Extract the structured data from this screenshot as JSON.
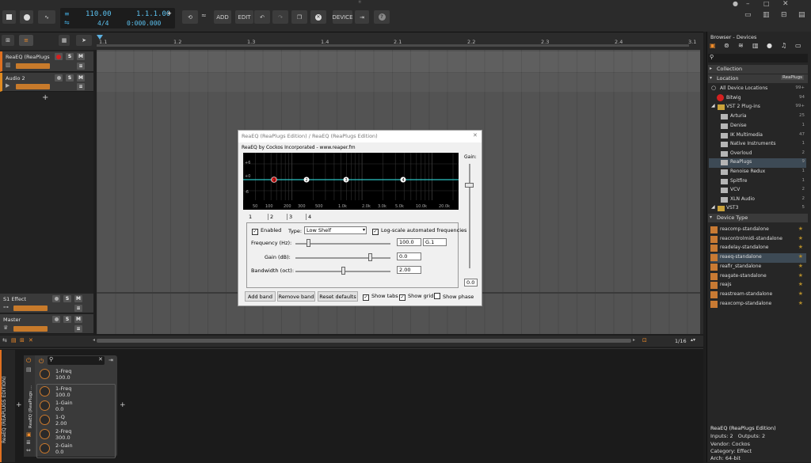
{
  "transport": {
    "tempo": "110.00",
    "time_signature": "4/4",
    "position_bars": "1.1.1.00",
    "position_time": "0:000.000",
    "add_label": "ADD",
    "edit_label": "EDIT",
    "device_label": "DEVICE"
  },
  "ruler": {
    "marks": [
      "1.1",
      "1.2",
      "1.3",
      "1.4",
      "2.1",
      "2.2",
      "2.3",
      "2.4",
      "3.1"
    ]
  },
  "tracks": [
    {
      "name": "ReaEQ (ReaPlugs ...",
      "s": "S",
      "m": "M"
    },
    {
      "name": "Audio 2",
      "s": "S",
      "m": "M"
    },
    {
      "name": "S1 Effect",
      "s": "S",
      "m": "M"
    },
    {
      "name": "Master",
      "s": "S",
      "m": "M"
    }
  ],
  "arranger": {
    "add_track": "+",
    "zoom": "1/16"
  },
  "browser": {
    "title": "Browser - Devices",
    "search_placeholder": "",
    "collection_label": "Collection",
    "location_label": "Location",
    "location_value": "ReaPlugs",
    "all_locations": {
      "label": "All Device Locations",
      "count": "99+"
    },
    "bitwig": {
      "label": "Bitwig",
      "count": "94"
    },
    "vst2": {
      "label": "VST 2 Plug-ins",
      "count": "99+"
    },
    "folders": [
      {
        "label": "Arturia",
        "count": "25"
      },
      {
        "label": "Denise",
        "count": "1"
      },
      {
        "label": "IK Multimedia",
        "count": "47"
      },
      {
        "label": "Native Instruments",
        "count": "1"
      },
      {
        "label": "Overloud",
        "count": "2"
      },
      {
        "label": "ReaPlugs",
        "count": "9"
      },
      {
        "label": "Renoise Redux",
        "count": "1"
      },
      {
        "label": "Spitfire",
        "count": "1"
      },
      {
        "label": "VCV",
        "count": "2"
      },
      {
        "label": "XLN Audio",
        "count": "2"
      }
    ],
    "vst3": {
      "label": "VST3",
      "count": "5"
    },
    "device_type_label": "Device Type",
    "devices": [
      "reacomp-standalone",
      "reacontrolmidi-standalone",
      "readelay-standalone",
      "reaeq-standalone",
      "reafir_standalone",
      "reagate-standalone",
      "reajs",
      "reastream-standalone",
      "reaxcomp-standalone"
    ],
    "info": {
      "name": "ReaEQ (ReaPlugs Edition)",
      "io": "Inputs: 2   Outputs: 2",
      "vendor": "Vendor: Cockos",
      "category": "Category: Effect",
      "arch": "Arch: 64-bit"
    }
  },
  "device_panel": {
    "track_label": "ReaEQ (REAPLUGS EDITION)",
    "device_label": "ReaEQ (ReaPlugs ...",
    "search_placeholder": "",
    "params": [
      {
        "name": "1-Freq",
        "value": "100.0"
      },
      {
        "name": "1-Freq",
        "value": "100.0"
      },
      {
        "name": "1-Gain",
        "value": "0.0"
      },
      {
        "name": "1-Q",
        "value": "2.00"
      },
      {
        "name": "2-Freq",
        "value": "300.0"
      },
      {
        "name": "2-Gain",
        "value": "0.0"
      }
    ],
    "plus": "+"
  },
  "reaeq": {
    "title": "ReaEQ (ReaPlugs Edition) / ReaEQ (ReaPlugs Edition)",
    "subtitle": "ReaEQ by Cockos Incorporated - www.reaper.fm",
    "gain_label": "Gain:",
    "gain_value": "0.0",
    "db_labels": [
      "+6",
      "+0",
      "-6"
    ],
    "freq_labels": [
      "50",
      "100",
      "200",
      "300",
      "500",
      "1.0k",
      "2.0k",
      "3.0k",
      "5.0k",
      "10.0k",
      "20.0k"
    ],
    "band_points": [
      "1",
      "2",
      "3",
      "4"
    ],
    "tabs": [
      "1",
      "2",
      "3",
      "4"
    ],
    "enabled_label": "Enabled",
    "type_label": "Type:",
    "type_value": "Low Shelf",
    "log_label": "Log-scale automated frequencies",
    "freq_label": "Frequency (Hz):",
    "freq_value": "100.0",
    "freq_note": "G.1",
    "gain_db_label": "Gain (dB):",
    "gain_db_value": "0.0",
    "bw_label": "Bandwidth (oct):",
    "bw_value": "2.00",
    "add_band": "Add band",
    "remove_band": "Remove band",
    "reset_defaults": "Reset defaults",
    "show_tabs": "Show tabs",
    "show_grid": "Show grid",
    "show_phase": "Show phase"
  },
  "colors": {
    "accent": "#f08c2a",
    "curve": "#2ec4c4",
    "selected_point": "#d42020",
    "record": "#d42020"
  }
}
